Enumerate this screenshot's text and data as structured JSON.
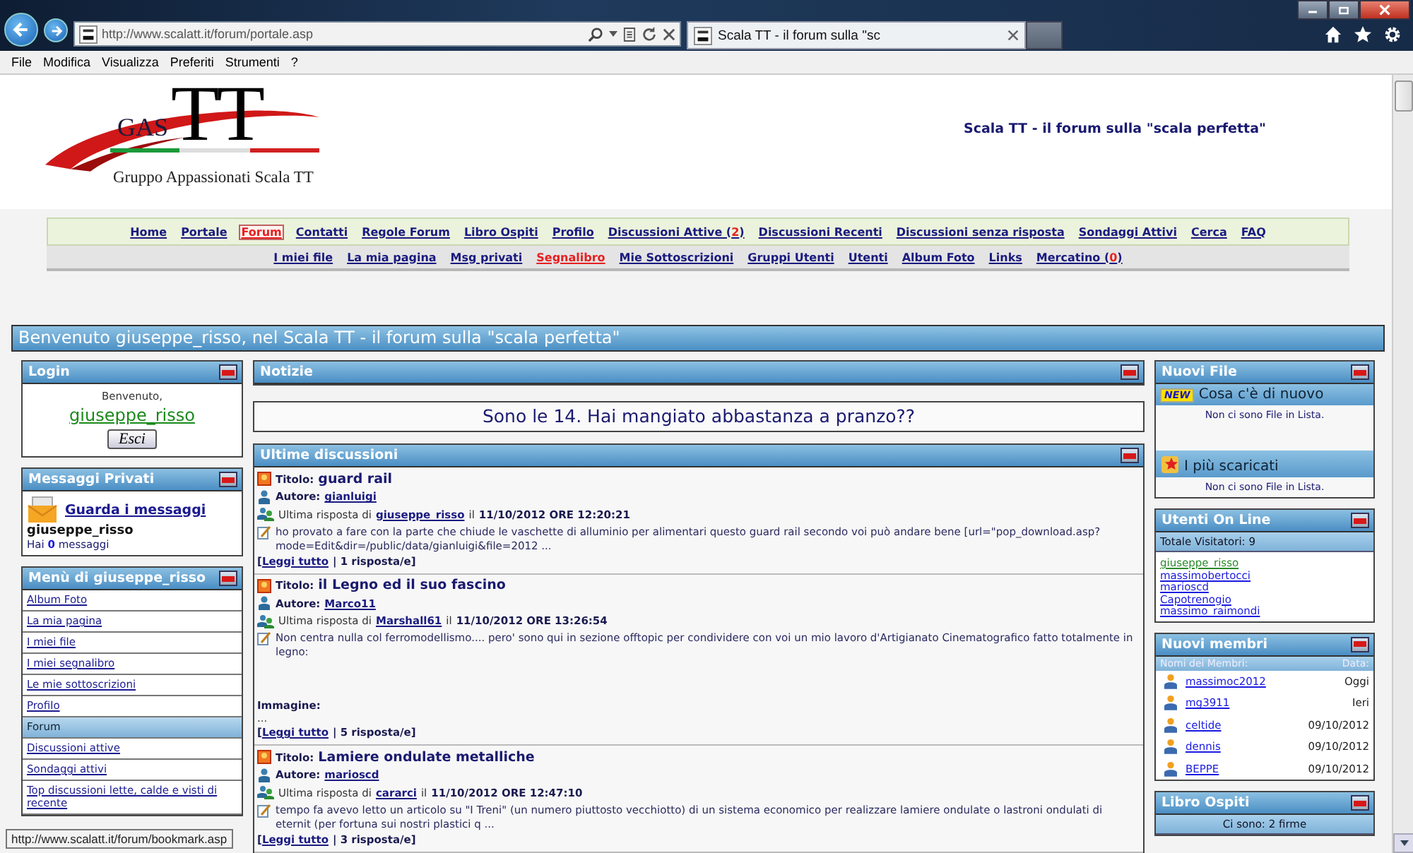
{
  "browser": {
    "address": "http://www.scalatt.it/forum/portale.asp",
    "tab_title": "Scala TT - il forum sulla \"sc",
    "menu": [
      "File",
      "Modifica",
      "Visualizza",
      "Preferiti",
      "Strumenti",
      "?"
    ]
  },
  "header": {
    "logo_small": "GAS",
    "logo_big": "TT",
    "logo_subtitle": "Gruppo Appassionati Scala TT",
    "site_title": "Scala TT - il forum sulla \"scala perfetta\""
  },
  "nav_main": [
    {
      "label": "Home",
      "selected": false,
      "highlighted": false
    },
    {
      "label": "Portale",
      "selected": false,
      "highlighted": false
    },
    {
      "label": "Forum",
      "selected": true,
      "highlighted": true
    },
    {
      "label": "Contatti",
      "selected": false,
      "highlighted": false
    },
    {
      "label": "Regole Forum",
      "selected": false,
      "highlighted": false
    },
    {
      "label": "Libro Ospiti",
      "selected": false,
      "highlighted": false
    },
    {
      "label": "Profilo",
      "selected": false,
      "highlighted": false
    },
    {
      "label": "Discussioni Attive (",
      "count": "2",
      "tail": ")",
      "selected": false,
      "highlighted": false
    },
    {
      "label": "Discussioni Recenti",
      "selected": false,
      "highlighted": false
    },
    {
      "label": "Discussioni senza risposta",
      "selected": false,
      "highlighted": false
    },
    {
      "label": "Sondaggi Attivi",
      "selected": false,
      "highlighted": false
    },
    {
      "label": "Cerca",
      "selected": false,
      "highlighted": false
    },
    {
      "label": "FAQ",
      "selected": false,
      "highlighted": false
    }
  ],
  "nav_user": [
    {
      "label": "I miei file",
      "selected": false,
      "highlighted": false
    },
    {
      "label": "La mia pagina",
      "selected": false,
      "highlighted": false
    },
    {
      "label": "Msg privati",
      "selected": false,
      "highlighted": false
    },
    {
      "label": "Segnalibro",
      "selected": false,
      "highlighted": true
    },
    {
      "label": "Mie Sottoscrizioni",
      "selected": false,
      "highlighted": false
    },
    {
      "label": "Gruppi Utenti",
      "selected": false,
      "highlighted": false
    },
    {
      "label": "Utenti",
      "selected": false,
      "highlighted": false
    },
    {
      "label": "Album Foto",
      "selected": false,
      "highlighted": false
    },
    {
      "label": "Links",
      "selected": false,
      "highlighted": false
    },
    {
      "label": "Mercatino (",
      "count": "0",
      "tail": ")",
      "selected": false,
      "highlighted": false
    }
  ],
  "welcome": "Benvenuto giuseppe_risso, nel Scala TT - il forum sulla \"scala perfetta\"",
  "login": {
    "title": "Login",
    "greeting": "Benvenuto,",
    "username": "giuseppe_risso",
    "button": "Esci"
  },
  "private_messages": {
    "title": "Messaggi Privati",
    "link": "Guarda i messaggi",
    "username": "giuseppe_risso",
    "count": "Hai **0** messaggi"
  },
  "user_menu": {
    "title": "Menù di giuseppe_risso",
    "items": [
      {
        "kind": "link",
        "label": "Album Foto"
      },
      {
        "kind": "link",
        "label": "La mia pagina"
      },
      {
        "kind": "link",
        "label": "I miei file"
      },
      {
        "kind": "link",
        "label": "I miei segnalibro"
      },
      {
        "kind": "link",
        "label": "Le mie sottoscrizioni"
      },
      {
        "kind": "link",
        "label": "Profilo"
      },
      {
        "kind": "section",
        "label": "Forum"
      },
      {
        "kind": "link",
        "label": "Discussioni attive"
      },
      {
        "kind": "link",
        "label": "Sondaggi attivi"
      },
      {
        "kind": "link",
        "label": "Top discussioni lette, calde e visti di recente"
      }
    ]
  },
  "status_tooltip": "http://www.scalatt.it/forum/bookmark.asp",
  "news": {
    "title": "Notizie",
    "message": "Sono le 14. Hai mangiato abbastanza a pranzo??"
  },
  "discussions": {
    "title": "Ultime discussioni",
    "posts": [
      {
        "title_label": "Titolo:",
        "author_label": "Autore:",
        "reply_label": "Ultima risposta di",
        "date_label": "il",
        "title": "guard rail",
        "author": "gianluigi",
        "last_by": "giuseppe_risso",
        "date": "11/10/2012 ORE 12:20:21",
        "excerpt": "ho provato a fare con la parte che chiude le vaschette di alluminio per alimentari questo guard rail secondo voi può andare bene [url=\"pop_download.asp?mode=Edit&dir=/public/data/gianluigi&file=2012 ...",
        "open": "[",
        "read_more": "Leggi tutto",
        "replies": "| 1 risposta/e]"
      },
      {
        "title_label": "Titolo:",
        "author_label": "Autore:",
        "reply_label": "Ultima risposta di",
        "date_label": "il",
        "title": "il Legno ed il suo fascino",
        "author": "Marco11",
        "last_by": "Marshall61",
        "date": "11/10/2012 ORE 13:26:54",
        "excerpt": "Non centra nulla col ferromodellismo.... pero' sono qui in sezione offtopic per condividere con voi un mio lavoro d'Artigianato Cinematografico fatto totalmente in legno:",
        "image_label": "Immagine:",
        "image_value": "...",
        "open": "[",
        "read_more": "Leggi tutto",
        "replies": "| 5 risposta/e]"
      },
      {
        "title_label": "Titolo:",
        "author_label": "Autore:",
        "reply_label": "Ultima risposta di",
        "date_label": "il",
        "title": "Lamiere ondulate metalliche",
        "author": "marioscd",
        "last_by": "cararci",
        "date": "11/10/2012 ORE 12:47:10",
        "excerpt": "tempo fa avevo letto un articolo su \"I Treni\" (un numero piuttosto vecchiotto) di un sistema economico per realizzare lamiere ondulate o lastroni ondulati di eternit (per fortuna sui nostri plastici q ...",
        "open": "[",
        "read_more": "Leggi tutto",
        "replies": "| 3 risposta/e]"
      }
    ]
  },
  "new_files": {
    "title": "Nuovi File",
    "sections": [
      {
        "kind": "new",
        "badge": "NEW",
        "title": "Cosa c'è di nuovo",
        "empty": "Non ci sono File in Lista."
      },
      {
        "kind": "top",
        "title": "I più scaricati",
        "empty": "Non ci sono File in Lista."
      }
    ]
  },
  "online": {
    "title": "Utenti On Line",
    "total": "Totale Visitatori: 9",
    "users": [
      {
        "name": "giuseppe_risso",
        "self": true
      },
      {
        "name": "massimobertocci",
        "self": false
      },
      {
        "name": "marioscd",
        "self": false
      },
      {
        "name": "Capotrenogio",
        "self": false
      },
      {
        "name": "massimo_raimondi",
        "self": false
      }
    ]
  },
  "new_members": {
    "title": "Nuovi membri",
    "name_header": "Nomi dei Membri:",
    "date_header": "Data:",
    "members": [
      {
        "name": "massimoc2012",
        "date": "Oggi"
      },
      {
        "name": "mg3911",
        "date": "Ieri"
      },
      {
        "name": "celtide",
        "date": "09/10/2012"
      },
      {
        "name": "dennis",
        "date": "09/10/2012"
      },
      {
        "name": "BEPPE",
        "date": "09/10/2012"
      }
    ]
  },
  "guestbook": {
    "title": "Libro Ospiti",
    "text": "Ci sono: 2 firme"
  }
}
